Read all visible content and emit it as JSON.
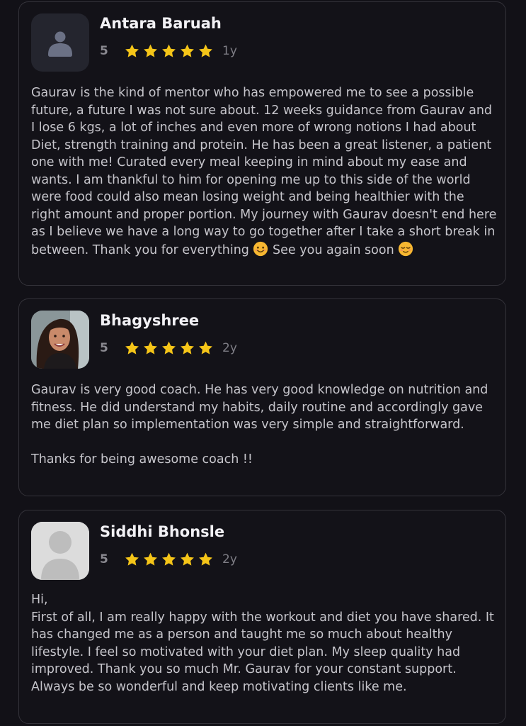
{
  "reviews": [
    {
      "name": "Antara Baruah",
      "rating": "5",
      "stars": 5,
      "age": "1y",
      "avatar": "default-person-icon",
      "text": "Gaurav is the kind of mentor who has empowered me to see a possible future, a future I was not sure about. 12 weeks guidance from Gaurav and I lose 6 kgs, a lot of inches and even more of wrong notions I had about Diet, strength training and protein. He has been a great listener, a patient one with me! Curated every meal keeping in mind about my ease and wants. I am thankful to him for opening me up to this side of the world were food could also mean losing weight and being healthier with the right amount and proper portion. My journey with Gaurav doesn't end here as I believe we have a long way to go together after I take a short break in between. Thank you for everything",
      "text_mid": "See you again soon",
      "emoji_1": "smiling-face-emoji",
      "emoji_2": "relieved-face-emoji"
    },
    {
      "name": "Bhagyshree",
      "rating": "5",
      "stars": 5,
      "age": "2y",
      "avatar": "profile-photo",
      "text": "Gaurav is very good coach. He has very good knowledge on nutrition and fitness. He did understand my habits, daily routine and accordingly gave me diet plan so implementation was very simple and straightforward.\n\nThanks for being awesome coach !!"
    },
    {
      "name": "Siddhi Bhonsle",
      "rating": "5",
      "stars": 5,
      "age": "2y",
      "avatar": "gray-default-avatar",
      "text": "Hi,\nFirst of all, I am really happy with the workout and diet you have shared. It has changed me as a person and taught me so much about healthy lifestyle. I feel so motivated with your diet plan. My sleep quality had improved. Thank you so much Mr. Gaurav for your constant support. Always be so wonderful and keep motivating clients like me."
    }
  ],
  "colors": {
    "background": "#121117",
    "card_border": "#34333a",
    "star": "#f5c518",
    "name": "#f2f1f5",
    "text": "#c6c5cb"
  }
}
